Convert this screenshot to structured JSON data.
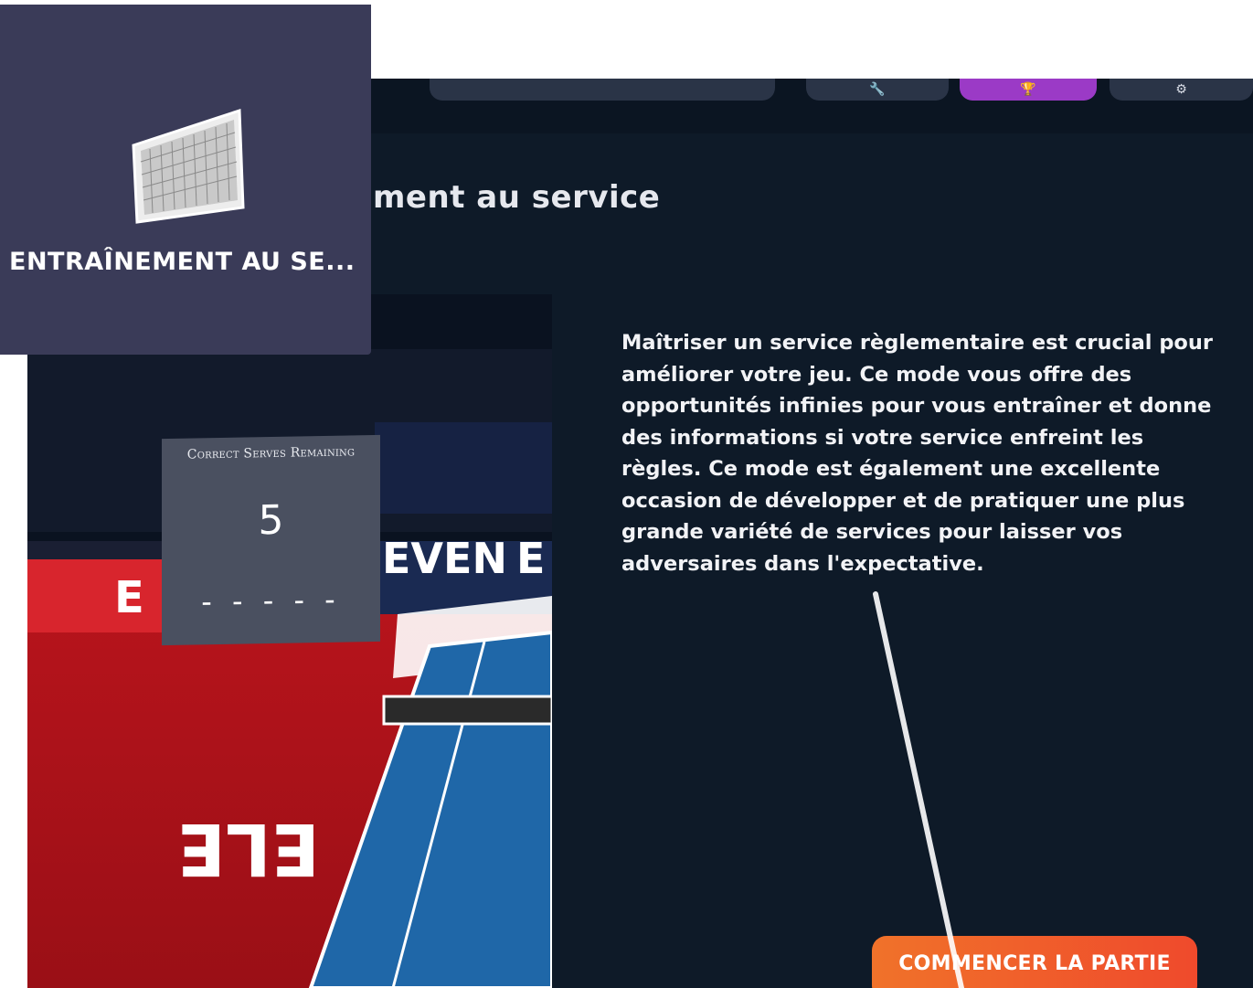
{
  "top_nav": {
    "tabs": [
      {
        "icon": "wrench-icon",
        "active": false
      },
      {
        "icon": "trophy-icon",
        "active": true
      },
      {
        "icon": "settings-icon",
        "active": false
      }
    ]
  },
  "mode_card": {
    "label": "ENTRAÎNEMENT AU SE...",
    "icon": "net-icon"
  },
  "page_title": "ment au service",
  "preview": {
    "counter_header": "Correct Serves Remaining",
    "counter_value": "5",
    "counter_dashes": "- - - - -",
    "icons": [
      "ping-pong-table-icon",
      "arena-banner-icon"
    ]
  },
  "description": "Maîtriser un service règlementaire est crucial pour améliorer votre jeu. Ce mode vous offre des opportunités infinies pour vous entraîner et donne des informations si votre service enfreint les règles. Ce mode est également une excellente occasion de développer et de pratiquer une plus grande variété de services pour laisser vos adversaires dans l'expectative.",
  "start_button": "COMMENCER LA PARTIE",
  "colors": {
    "panel": "#0e1a28",
    "active_tab": "#9b3ac6",
    "button_start": "#f0722a",
    "button_end": "#ef4a2c",
    "card": "#3a3b58"
  }
}
